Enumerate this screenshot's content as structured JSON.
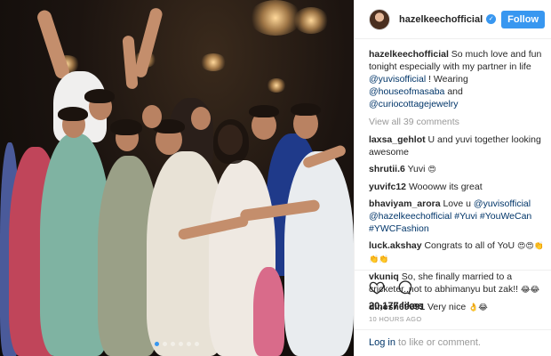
{
  "post": {
    "username": "hazelkeechofficial",
    "follow_label": "Follow",
    "caption": {
      "user": "hazelkeechofficial",
      "t1": "So much love and fun tonight especially with my partner in life",
      "m1": "@yuvisofficial",
      "t2": "! Wearing",
      "m2": "@houseofmasaba",
      "t3": "and",
      "m3": "@curiocottagejewelry"
    },
    "view_all": "View all 39 comments",
    "comments": [
      {
        "user": "laxsa_gehlot",
        "text": "U and yuvi together looking awesome"
      },
      {
        "user": "shrutii.6",
        "text": "Yuvi",
        "emoji": "😍"
      },
      {
        "user": "yuvifc12",
        "text": "Woooww its great"
      },
      {
        "user": "bhaviyam_arora",
        "text": "Love u",
        "m1": "@yuvisofficial",
        "m2": "@hazelkeechofficial",
        "h1": "#Yuvi",
        "h2": "#YouWeCan",
        "h3": "#YWCFashion"
      },
      {
        "user": "luck.akshay",
        "text": "Congrats to all of YoU",
        "emoji": "😍😍👏👏👏"
      },
      {
        "user": "vkuniq",
        "text": "So, she finally married to a cricketer..not to abhimanyu but zak!!",
        "emoji": "😂😂"
      },
      {
        "user": "dinesh69691",
        "text": "Very nice",
        "emoji": "👌😂"
      }
    ],
    "likes": "20,177 likes",
    "time": "10 HOURS AGO",
    "footer": {
      "login": "Log in",
      "rest": "to like or comment."
    }
  }
}
